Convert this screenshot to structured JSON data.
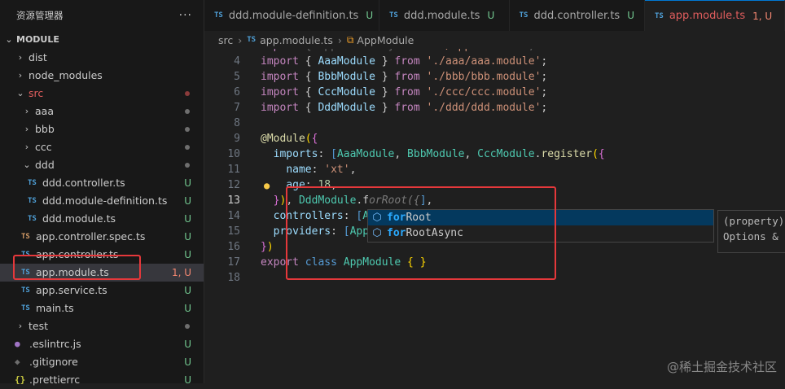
{
  "sidebar": {
    "title": "资源管理器",
    "more": "···",
    "items": [
      {
        "label": "MODULE",
        "kind": "root",
        "chev": "⌄"
      },
      {
        "label": "dist",
        "kind": "folder",
        "chev": "›"
      },
      {
        "label": "node_modules",
        "kind": "folder",
        "chev": "›"
      },
      {
        "label": "src",
        "kind": "folder-open",
        "chev": "⌄",
        "color": "#e05d5d"
      },
      {
        "label": "aaa",
        "kind": "folder",
        "chev": "›"
      },
      {
        "label": "bbb",
        "kind": "folder",
        "chev": "›"
      },
      {
        "label": "ccc",
        "kind": "folder",
        "chev": "›"
      },
      {
        "label": "ddd",
        "kind": "folder-open",
        "chev": "⌄"
      },
      {
        "label": "ddd.controller.ts",
        "kind": "file",
        "icon": "TS",
        "status": "U"
      },
      {
        "label": "ddd.module-definition.ts",
        "kind": "file",
        "icon": "TS",
        "status": "U"
      },
      {
        "label": "ddd.module.ts",
        "kind": "file",
        "icon": "TS",
        "status": "U"
      },
      {
        "label": "app.controller.spec.ts",
        "kind": "file",
        "icon": "TS",
        "status": "U"
      },
      {
        "label": "app.controller.ts",
        "kind": "file",
        "icon": "TS",
        "status": "U"
      },
      {
        "label": "app.module.ts",
        "kind": "file",
        "icon": "TS",
        "status": "1, U"
      },
      {
        "label": "app.service.ts",
        "kind": "file",
        "icon": "TS",
        "status": "U"
      },
      {
        "label": "main.ts",
        "kind": "file",
        "icon": "TS",
        "status": "U"
      },
      {
        "label": "test",
        "kind": "folder",
        "chev": "›"
      },
      {
        "label": ".eslintrc.js",
        "kind": "file",
        "icon": "●",
        "status": "U"
      },
      {
        "label": ".gitignore",
        "kind": "file",
        "icon": "◆",
        "status": "U"
      },
      {
        "label": ".prettierrc",
        "kind": "file",
        "icon": "{}",
        "status": "U"
      }
    ]
  },
  "tabs": [
    {
      "icon": "TS",
      "label": "ddd.module-definition.ts",
      "status": "U"
    },
    {
      "icon": "TS",
      "label": "ddd.module.ts",
      "status": "U"
    },
    {
      "icon": "TS",
      "label": "ddd.controller.ts",
      "status": "U"
    },
    {
      "icon": "TS",
      "label": "app.module.ts",
      "status": "1, U"
    }
  ],
  "breadcrumb": {
    "folder": "src",
    "file_icon": "TS",
    "file": "app.module.ts",
    "symbol": "AppModule"
  },
  "editor": {
    "line_numbers": [
      "4",
      "5",
      "6",
      "7",
      "8",
      "9",
      "10",
      "11",
      "12",
      "13",
      "14",
      "15",
      "16",
      "17",
      "18"
    ],
    "current_line": "13",
    "ghost_text": "orRoot({",
    "ghost_typed": "f"
  },
  "suggest": {
    "items": [
      {
        "match": "for",
        "rest": "Root"
      },
      {
        "match": "for",
        "rest": "RootAsync"
      }
    ],
    "detail_line1": "(property)",
    "detail_line2": "Options &"
  },
  "watermark": "@稀土掘金技术社区",
  "colors": {
    "accent": "#0078d4",
    "highlight_box": "#e5383b",
    "untracked": "#73c991",
    "error": "#f48771"
  }
}
